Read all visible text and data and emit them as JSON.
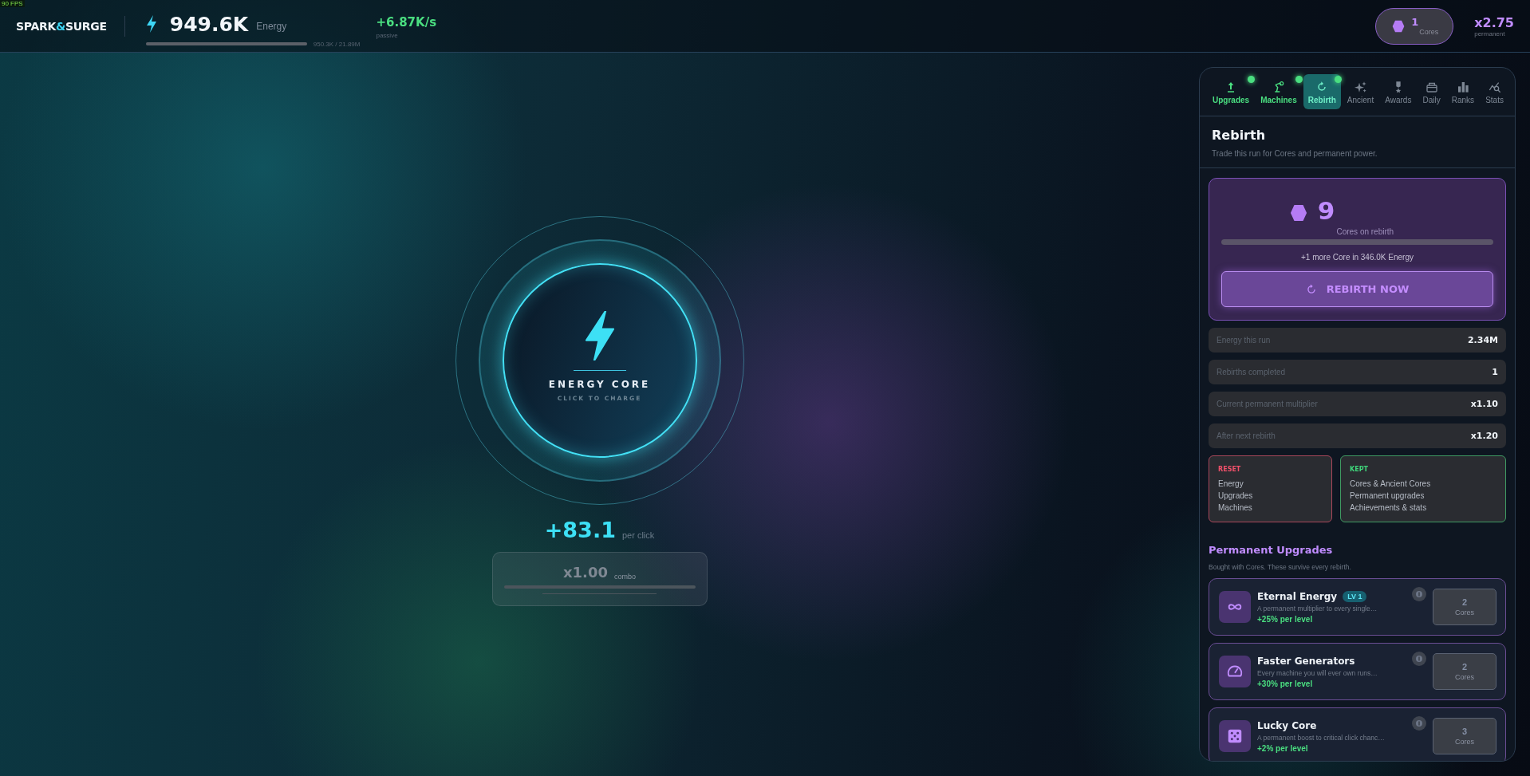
{
  "fps_counter": "90 FPS",
  "header": {
    "logo": {
      "first": "SPARK",
      "accent": "&",
      "last": "SURGE"
    },
    "energy": {
      "value": "949.6K",
      "unit": "Energy",
      "level": 1,
      "progress_text": "950.3K / 21.89M"
    },
    "rate": {
      "value": "+6.87K/s",
      "label": "passive"
    },
    "cores": {
      "value": "1",
      "label": "Cores"
    },
    "multiplier": {
      "value": "x2.75",
      "label": "permanent"
    }
  },
  "core": {
    "title": "ENERGY CORE",
    "subtitle": "CLICK TO CHARGE",
    "per_click": {
      "value": "+83.1",
      "label": "per click"
    },
    "combo": {
      "value": "x1.00",
      "label": "combo"
    }
  },
  "panel": {
    "tabs": [
      {
        "label": "Upgrades",
        "selected": false,
        "notify": true
      },
      {
        "label": "Machines",
        "selected": false,
        "notify": true
      },
      {
        "label": "Rebirth",
        "selected": true,
        "notify": true
      },
      {
        "label": "Ancient",
        "selected": false,
        "notify": false
      },
      {
        "label": "Awards",
        "selected": false,
        "notify": false
      },
      {
        "label": "Daily",
        "selected": false,
        "notify": false
      },
      {
        "label": "Ranks",
        "selected": false,
        "notify": false
      },
      {
        "label": "Stats",
        "selected": false,
        "notify": false
      }
    ],
    "title": "Rebirth",
    "subtitle": "Trade this run for Cores and permanent power.",
    "rebirth": {
      "cores": "9",
      "cores_label": "Cores on rebirth",
      "level": 1,
      "next_text": "+1 more Core in 346.0K Energy",
      "button": "REBIRTH NOW"
    },
    "stats": [
      {
        "label": "Energy this run",
        "value": "2.34M"
      },
      {
        "label": "Rebirths completed",
        "value": "1"
      },
      {
        "label": "Current permanent multiplier",
        "value": "x1.10"
      },
      {
        "label": "After next rebirth",
        "value": "x1.20"
      }
    ],
    "lists": [
      {
        "kind": "reset",
        "title": "RESET",
        "items": [
          "Energy",
          "Upgrades",
          "Machines"
        ]
      },
      {
        "kind": "kept",
        "title": "KEPT",
        "items": [
          "Cores & Ancient Cores",
          "Permanent upgrades",
          "Achievements & stats"
        ]
      }
    ],
    "upgrades_title": "Permanent Upgrades",
    "upgrades_subtitle": "Bought with Cores. These survive every rebirth.",
    "upgrades": [
      {
        "name": "Eternal Energy",
        "level_badge": "LV 1",
        "description": "A permanent multiplier to every single…",
        "effect": "+25% per level",
        "cost": "2",
        "cost_unit": "Cores",
        "disabled": true
      },
      {
        "name": "Faster Generators",
        "description": "Every machine you will ever own runs…",
        "effect": "+30% per level",
        "cost": "2",
        "cost_unit": "Cores",
        "disabled": true
      },
      {
        "name": "Lucky Core",
        "description": "A permanent boost to critical click chanc…",
        "effect": "+2% per level",
        "cost": "3",
        "cost_unit": "Cores",
        "disabled": true
      }
    ]
  }
}
